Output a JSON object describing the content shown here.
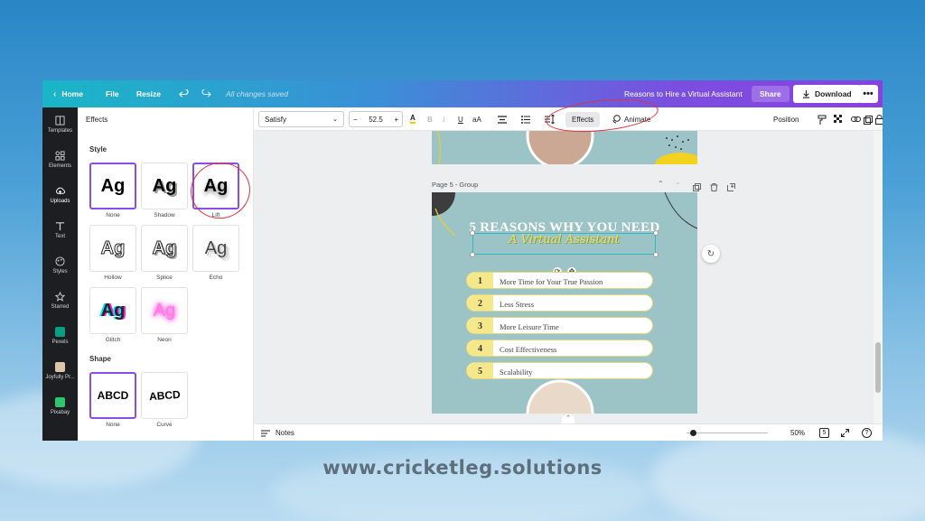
{
  "topbar": {
    "home": "Home",
    "file": "File",
    "resize": "Resize",
    "saved_status": "All changes saved",
    "doc_title": "Reasons to Hire a Virtual Assistant",
    "share": "Share",
    "download": "Download",
    "more": "•••"
  },
  "siderail": {
    "items": [
      {
        "label": "Templates",
        "icon": "templates-icon"
      },
      {
        "label": "Elements",
        "icon": "elements-icon"
      },
      {
        "label": "Uploads",
        "icon": "uploads-icon"
      },
      {
        "label": "Text",
        "icon": "text-icon"
      },
      {
        "label": "Styles",
        "icon": "styles-icon"
      },
      {
        "label": "Starred",
        "icon": "star-icon"
      },
      {
        "label": "Pexels",
        "icon": "pexels-icon"
      },
      {
        "label": "Joyfully Pr...",
        "icon": "joyfully-icon"
      },
      {
        "label": "Pixabay",
        "icon": "pixabay-icon"
      }
    ]
  },
  "panel": {
    "title": "Effects",
    "style_label": "Style",
    "style_sample": "Ag",
    "styles": [
      "None",
      "Shadow",
      "Lift",
      "Hollow",
      "Splice",
      "Echo",
      "Glitch",
      "Neon"
    ],
    "shape_label": "Shape",
    "shape_sample": "ABCD",
    "shapes": [
      "None",
      "Curve"
    ]
  },
  "toolbar": {
    "font": "Satisfy",
    "size_minus": "−",
    "font_size": "52.5",
    "size_plus": "+",
    "effects": "Effects",
    "animate": "Animate",
    "position": "Position"
  },
  "canvas": {
    "page_label": "Page 5 - Group",
    "headline": "5 REASONS WHY YOU NEED",
    "subhead": "A Virtual Assistant",
    "reasons": [
      {
        "num": "1",
        "text": "More Time for Your True Passion"
      },
      {
        "num": "2",
        "text": "Less Stress"
      },
      {
        "num": "3",
        "text": "More Leisure Time"
      },
      {
        "num": "4",
        "text": "Cost Effectiveness"
      },
      {
        "num": "5",
        "text": "Scalability"
      }
    ]
  },
  "bottombar": {
    "notes": "Notes",
    "zoom": "50%",
    "page_count": "5",
    "help": "?"
  },
  "watermark": "www.cricketleg.solutions",
  "colors": {
    "accent": "#8b4de8",
    "annotation": "#e0323b",
    "page_bg": "#9cc4c6",
    "highlight": "#f5e88a"
  }
}
